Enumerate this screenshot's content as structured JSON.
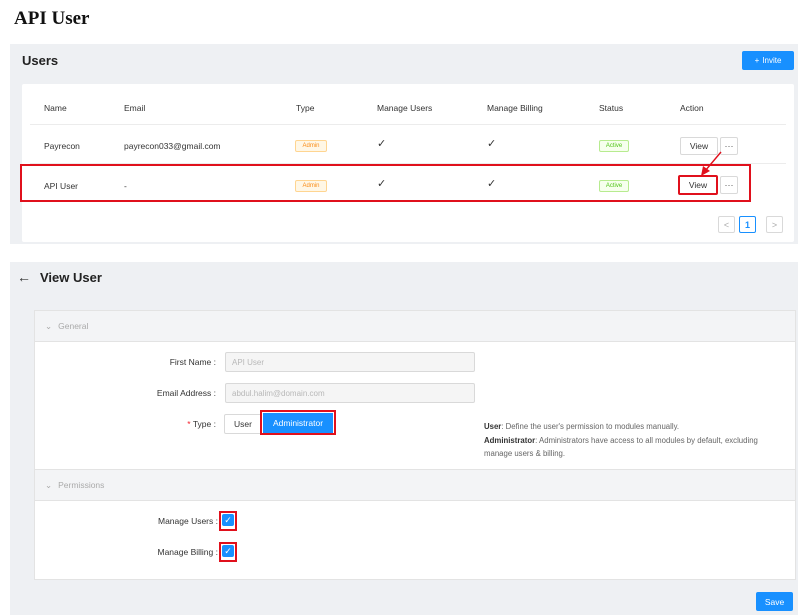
{
  "doc_title": "API User",
  "users_panel": {
    "title": "Users",
    "invite_button": {
      "icon": "plus-icon",
      "label": "Invite"
    },
    "columns": [
      "Name",
      "Email",
      "Type",
      "Manage Users",
      "Manage Billing",
      "Status",
      "Action"
    ],
    "rows": [
      {
        "name": "Payrecon",
        "email": "payrecon033@gmail.com",
        "type": "Admin",
        "manage_users": "✓",
        "manage_billing": "✓",
        "status": "Active",
        "view": "View",
        "more": "···"
      },
      {
        "name": "API User",
        "email": "-",
        "type": "Admin",
        "manage_users": "✓",
        "manage_billing": "✓",
        "status": "Active",
        "view": "View",
        "more": "···"
      }
    ],
    "pagination": {
      "prev": "<",
      "current": "1",
      "next": ">"
    }
  },
  "view_user": {
    "back_icon": "←",
    "title": "View User",
    "general": {
      "header": "General",
      "first_name_label": "First Name",
      "first_name_value": "API User",
      "email_label": "Email Address",
      "email_value": "abdul.halim@domain.com",
      "type_required": "*",
      "type_label": "Type",
      "type_options": [
        "User",
        "Administrator"
      ],
      "type_selected": "Administrator",
      "help_user_term": "User",
      "help_user_text": ": Define the user's permission to modules manually.",
      "help_admin_term": "Administrator",
      "help_admin_text": ": Administrators have access to all modules by default, excluding manage users & billing."
    },
    "permissions": {
      "header": "Permissions",
      "manage_users_label": "Manage Users",
      "manage_users_checked": true,
      "manage_billing_label": "Manage Billing",
      "manage_billing_checked": true
    },
    "save_label": "Save"
  },
  "colors": {
    "accent": "#1890ff",
    "highlight": "#e0101c",
    "admin_badge": "#fa8c16",
    "active_badge": "#52c41a"
  }
}
